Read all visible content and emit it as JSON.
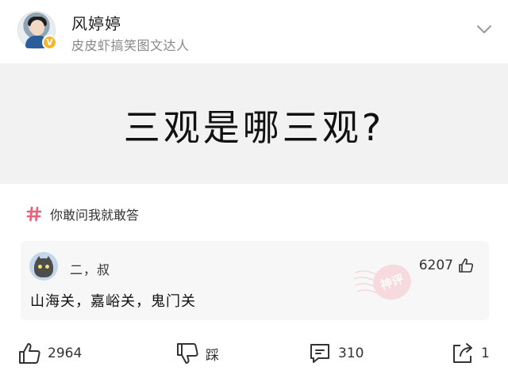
{
  "author": {
    "name": "风婷婷",
    "title": "皮皮虾搞笑图文达人",
    "badge_icon": "verified-v-icon"
  },
  "post": {
    "image_text": "三观是哪三观?",
    "topic_icon": "hashtag-icon",
    "topic": "你敢问我就敢答"
  },
  "hot_comment": {
    "name": "二，叔",
    "likes": "6207",
    "text": "山海关，嘉峪关，鬼门关",
    "stamp_text": "神评"
  },
  "toolbar": {
    "likes": "2964",
    "dislike_label": "踩",
    "comments": "310",
    "shares": "1"
  },
  "colors": {
    "hashtag": "#e8607a",
    "badge": "#f7b52c",
    "stamp": "#f2a7b0"
  }
}
